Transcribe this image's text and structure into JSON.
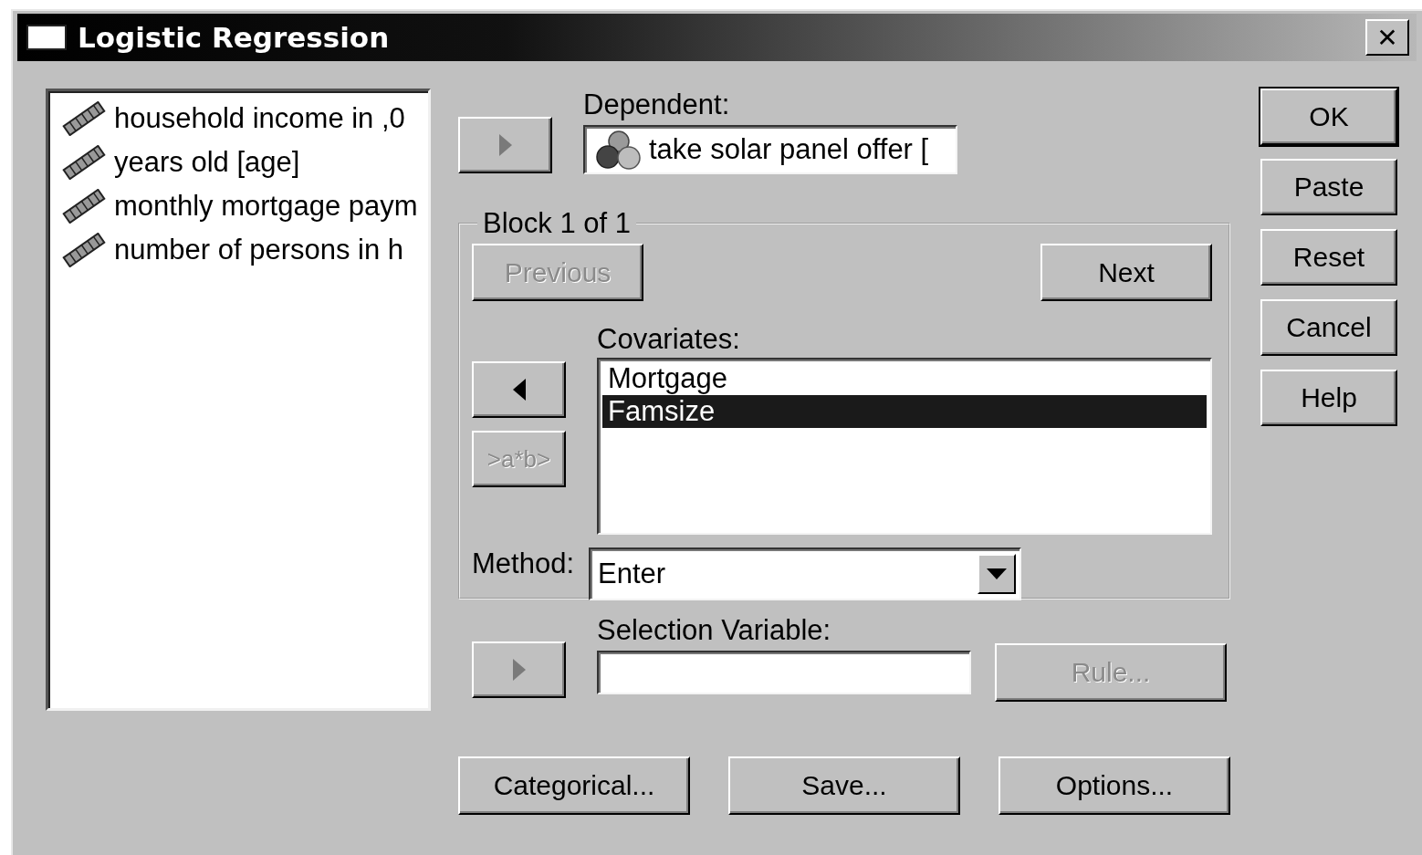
{
  "window": {
    "title": "Logistic Regression",
    "close": "✕"
  },
  "variables": [
    {
      "label": "household income in ,0"
    },
    {
      "label": "years old [age]"
    },
    {
      "label": "monthly mortgage paym"
    },
    {
      "label": "number of persons in h"
    }
  ],
  "dependent": {
    "label": "Dependent:",
    "value": "take solar panel offer ["
  },
  "block": {
    "title": "Block 1 of 1",
    "previous": {
      "label": "Previous",
      "disabled": true
    },
    "next": {
      "label": "Next",
      "disabled": false
    }
  },
  "covariates": {
    "label": "Covariates:",
    "items": [
      {
        "name": "Mortgage",
        "selected": false
      },
      {
        "name": "Famsize",
        "selected": true
      }
    ]
  },
  "interaction_button": {
    "label": ">a*b>",
    "disabled": true
  },
  "method": {
    "label": "Method:",
    "value": "Enter"
  },
  "selection_variable": {
    "label": "Selection Variable:"
  },
  "rule_button": {
    "label": "Rule...",
    "disabled": true
  },
  "bottom_buttons": [
    {
      "label": "Categorical..."
    },
    {
      "label": "Save..."
    },
    {
      "label": "Options..."
    }
  ],
  "side_buttons": [
    {
      "label": "OK",
      "default": true
    },
    {
      "label": "Paste",
      "default": false
    },
    {
      "label": "Reset",
      "default": false
    },
    {
      "label": "Cancel",
      "default": false
    },
    {
      "label": "Help",
      "default": false
    }
  ]
}
